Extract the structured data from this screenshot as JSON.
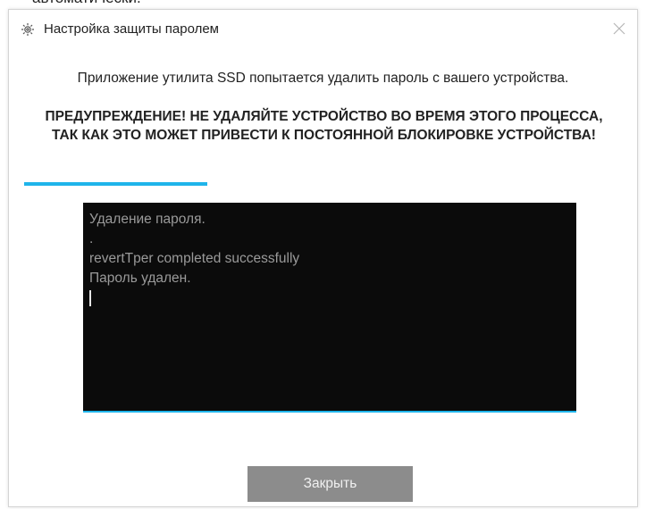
{
  "background": {
    "partial_text": "автоматически."
  },
  "dialog": {
    "title": "Настройка защиты паролем",
    "title_icon": "gear-icon",
    "close_icon": "close-icon",
    "message": "Приложение утилита SSD попытается удалить пароль с вашего устройства.",
    "warning": "ПРЕДУПРЕЖДЕНИЕ! НЕ УДАЛЯЙТЕ УСТРОЙСТВО ВО ВРЕМЯ ЭТОГО ПРОЦЕССА, ТАК КАК ЭТО МОЖЕТ ПРИВЕСТИ К ПОСТОЯННОЙ БЛОКИРОВКЕ УСТРОЙСТВА!",
    "progress": 0.31,
    "console_lines": [
      "Удаление пароля.",
      ".",
      "revertTper completed successfully",
      "Пароль удален."
    ],
    "close_button_label": "Закрыть"
  },
  "colors": {
    "accent": "#1fb4ea",
    "console_bg": "#0b0b0b",
    "console_text": "#9a9a9a",
    "button_bg": "#8c8c8c"
  }
}
